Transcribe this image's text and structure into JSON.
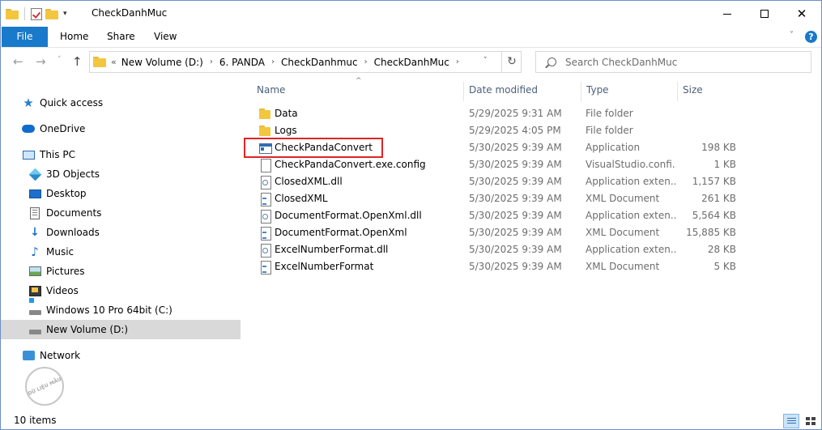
{
  "window": {
    "title": "CheckDanhMuc"
  },
  "ribbon": {
    "tabs": [
      "File",
      "Home",
      "Share",
      "View"
    ]
  },
  "address": {
    "crumbs": [
      "New Volume (D:)",
      "6. PANDA",
      "CheckDanhmuc",
      "CheckDanhMuc"
    ],
    "overflow_label": "«"
  },
  "search": {
    "placeholder": "Search CheckDanhMuc"
  },
  "sidebar": {
    "items": [
      {
        "label": "Quick access",
        "icon": "star-icon"
      },
      {
        "label": "OneDrive",
        "icon": "cloud-icon"
      },
      {
        "label": "This PC",
        "icon": "computer-icon"
      },
      {
        "label": "3D Objects",
        "icon": "cube-icon"
      },
      {
        "label": "Desktop",
        "icon": "desktop-icon"
      },
      {
        "label": "Documents",
        "icon": "documents-icon"
      },
      {
        "label": "Downloads",
        "icon": "download-icon"
      },
      {
        "label": "Music",
        "icon": "music-icon"
      },
      {
        "label": "Pictures",
        "icon": "pictures-icon"
      },
      {
        "label": "Videos",
        "icon": "videos-icon"
      },
      {
        "label": "Windows 10 Pro 64bit (C:)",
        "icon": "system-drive-icon"
      },
      {
        "label": "New Volume (D:)",
        "icon": "drive-icon",
        "selected": true
      },
      {
        "label": "Network",
        "icon": "network-icon"
      }
    ]
  },
  "columns": {
    "name": "Name",
    "date": "Date modified",
    "type": "Type",
    "size": "Size"
  },
  "files": [
    {
      "name": "Data",
      "date": "5/29/2025 9:31 AM",
      "type": "File folder",
      "size": "",
      "icon": "folder"
    },
    {
      "name": "Logs",
      "date": "5/29/2025 4:05 PM",
      "type": "File folder",
      "size": "",
      "icon": "folder"
    },
    {
      "name": "CheckPandaConvert",
      "date": "5/30/2025 9:39 AM",
      "type": "Application",
      "size": "198 KB",
      "icon": "app",
      "highlighted": true
    },
    {
      "name": "CheckPandaConvert.exe.config",
      "date": "5/30/2025 9:39 AM",
      "type": "VisualStudio.confi...",
      "size": "1 KB",
      "icon": "file"
    },
    {
      "name": "ClosedXML.dll",
      "date": "5/30/2025 9:39 AM",
      "type": "Application exten...",
      "size": "1,157 KB",
      "icon": "ext"
    },
    {
      "name": "ClosedXML",
      "date": "5/30/2025 9:39 AM",
      "type": "XML Document",
      "size": "261 KB",
      "icon": "xml"
    },
    {
      "name": "DocumentFormat.OpenXml.dll",
      "date": "5/30/2025 9:39 AM",
      "type": "Application exten...",
      "size": "5,564 KB",
      "icon": "ext"
    },
    {
      "name": "DocumentFormat.OpenXml",
      "date": "5/30/2025 9:39 AM",
      "type": "XML Document",
      "size": "15,885 KB",
      "icon": "xml"
    },
    {
      "name": "ExcelNumberFormat.dll",
      "date": "5/30/2025 9:39 AM",
      "type": "Application exten...",
      "size": "28 KB",
      "icon": "ext"
    },
    {
      "name": "ExcelNumberFormat",
      "date": "5/30/2025 9:39 AM",
      "type": "XML Document",
      "size": "5 KB",
      "icon": "xml"
    }
  ],
  "status": {
    "count": "10 items"
  },
  "watermark": {
    "text": "DỮ LIỆU MẪU"
  },
  "colors": {
    "accent": "#1979ca",
    "highlight_border": "#e02424",
    "selected_bg": "#d9d9d9"
  }
}
